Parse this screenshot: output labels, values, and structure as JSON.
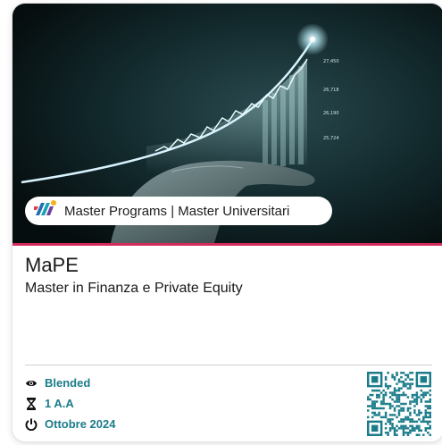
{
  "badge": {
    "label": "Master Programs | Master Universitari"
  },
  "course": {
    "title": "MaPE",
    "subtitle": "Master in Finanza  e Private Equity"
  },
  "info": {
    "mode": "Blended",
    "duration": "1 A.A",
    "start": "Ottobre 2024"
  },
  "chart_labels": [
    "27,450",
    "26,718",
    "26,190",
    "25,724"
  ],
  "colors": {
    "accent": "#d42a5c",
    "info_text": "#1b7c8a",
    "qr": "#1b7c8a"
  }
}
